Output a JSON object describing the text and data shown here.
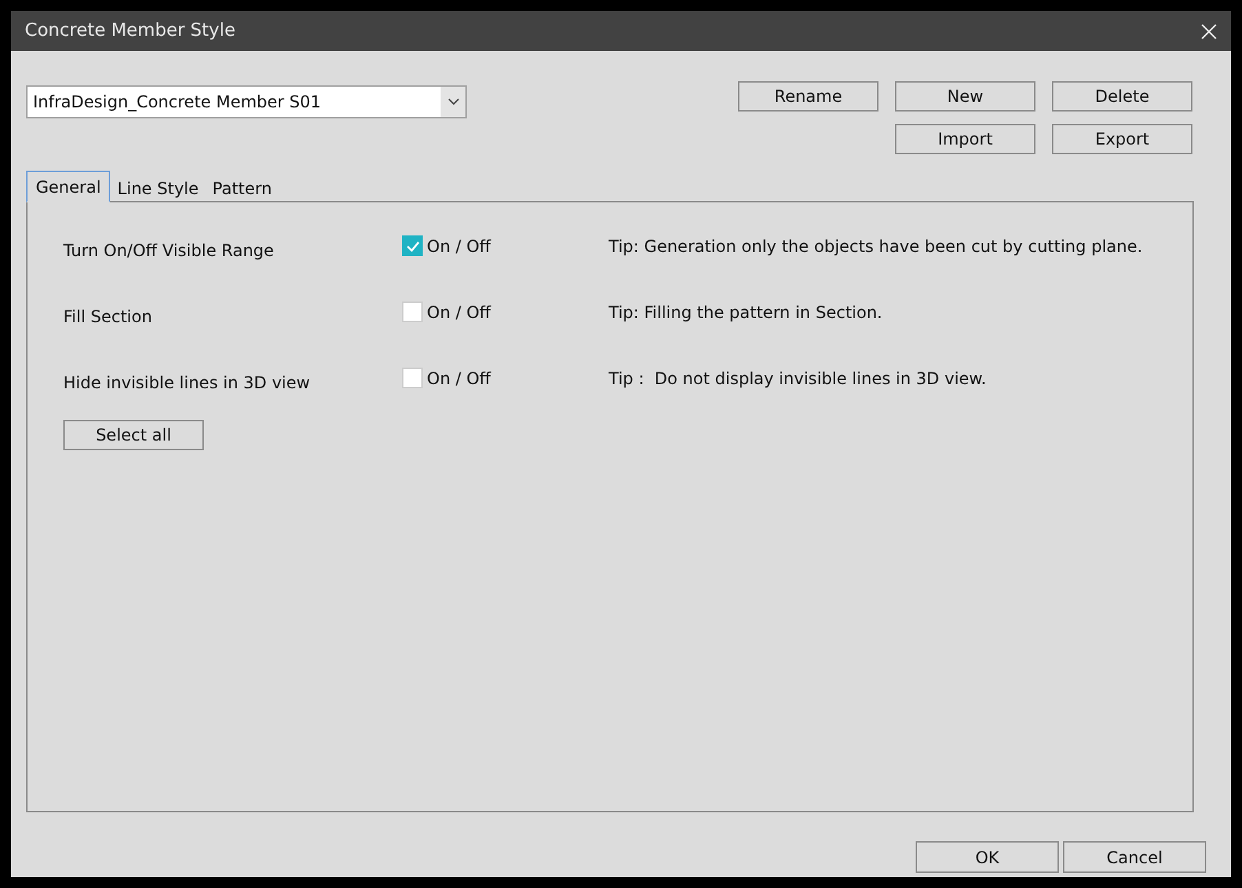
{
  "window": {
    "title": "Concrete Member Style"
  },
  "style_dropdown": {
    "value": "InfraDesign_Concrete Member S01"
  },
  "action_rows": [
    {
      "buttons": [
        "Rename",
        "New",
        "Delete"
      ]
    },
    {
      "buttons": [
        "Import",
        "Export"
      ]
    }
  ],
  "tabs": [
    {
      "label": "General",
      "selected": true
    },
    {
      "label": "Line Style",
      "selected": false
    },
    {
      "label": "Pattern",
      "selected": false
    }
  ],
  "options": [
    {
      "label": "Turn On/Off Visible Range",
      "checked": true,
      "toggle_label": "On / Off",
      "tip": "Tip: Generation only the objects have been cut by cutting plane."
    },
    {
      "label": "Fill Section",
      "checked": false,
      "toggle_label": "On / Off",
      "tip": "Tip: Filling the pattern in Section."
    },
    {
      "label": "Hide invisible lines in 3D view",
      "checked": false,
      "toggle_label": "On / Off",
      "tip": "Tip :  Do not display invisible lines in 3D view."
    }
  ],
  "select_all_button": "Select all",
  "footer_buttons": [
    "OK",
    "Cancel"
  ]
}
